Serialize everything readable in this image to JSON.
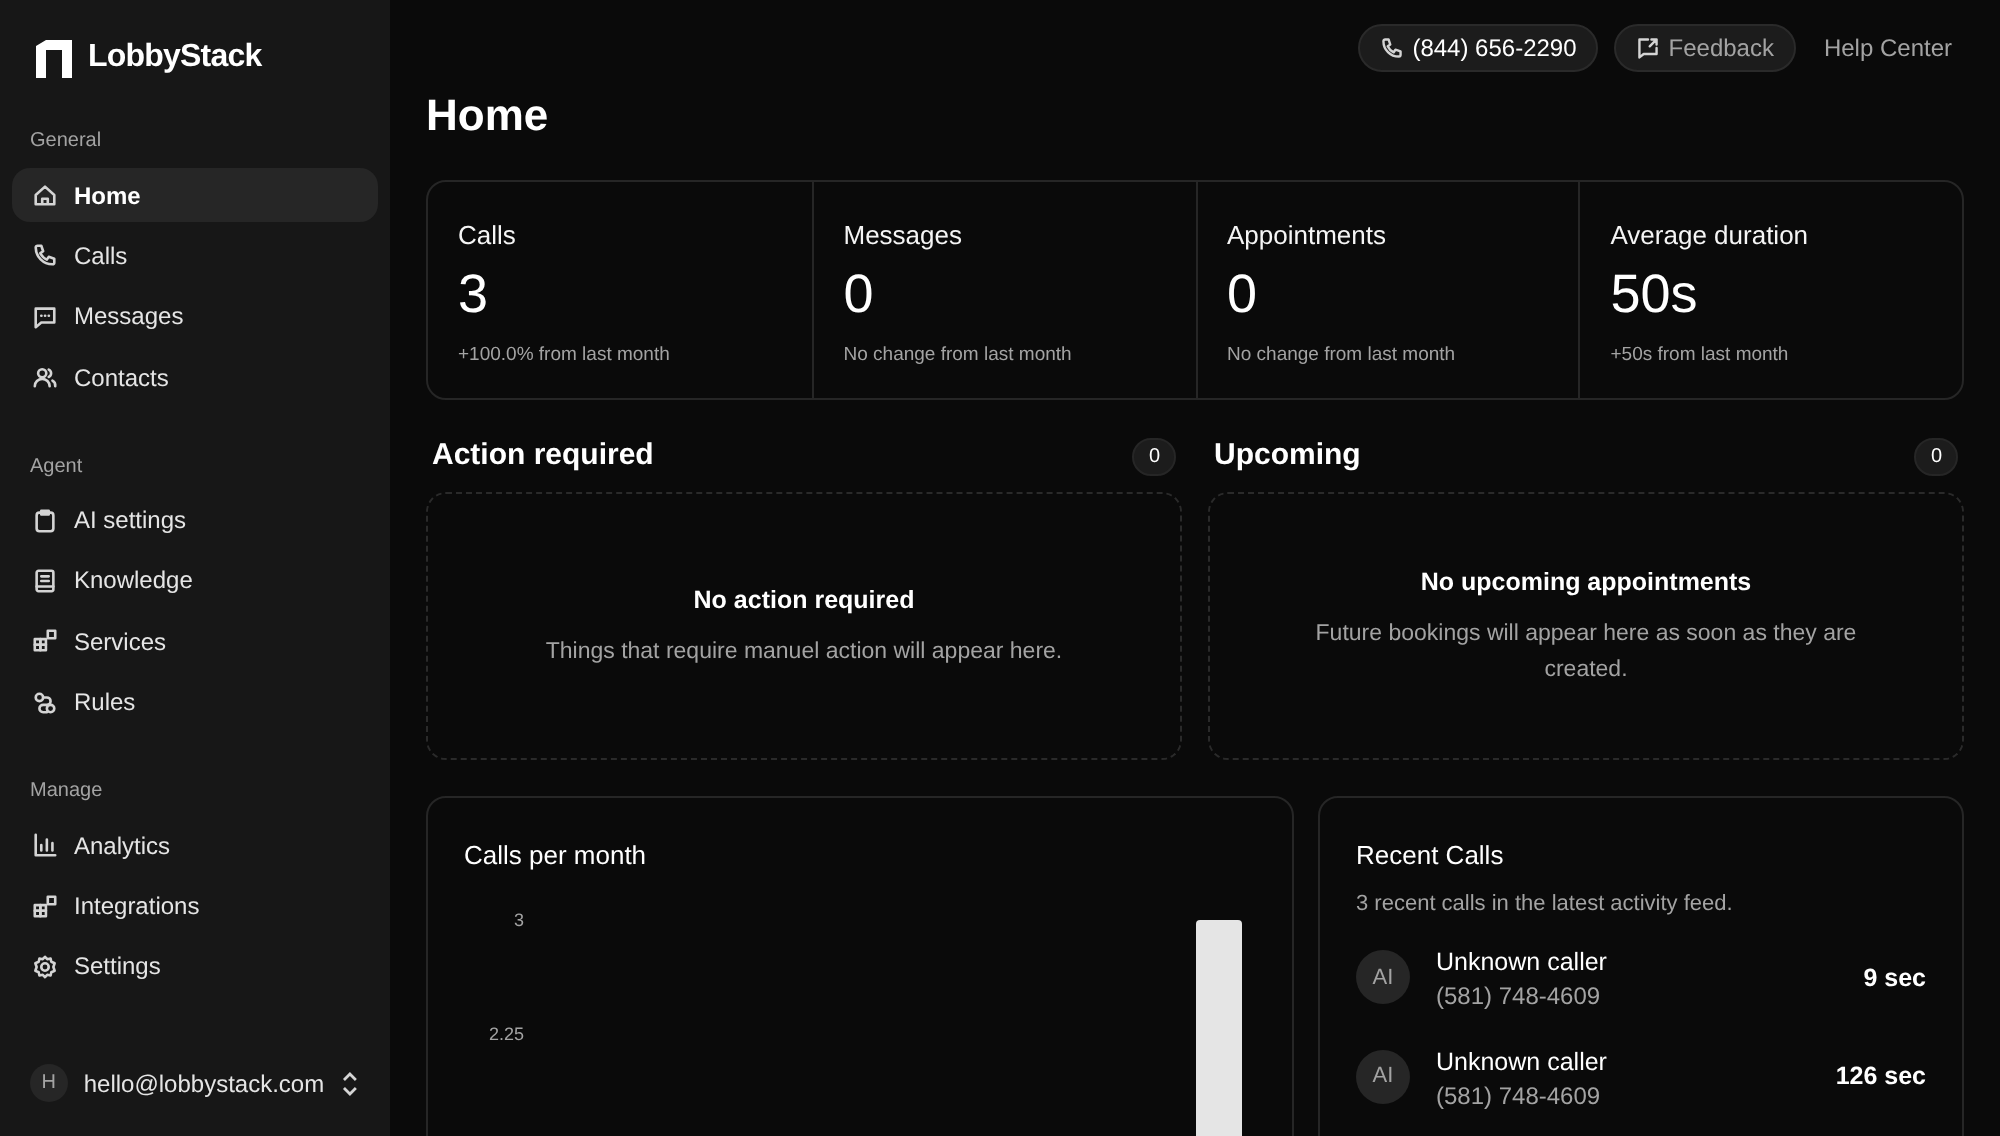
{
  "sidebar": {
    "brand": "LobbyStack",
    "sections": [
      {
        "title": "General",
        "items": [
          {
            "label": "Home",
            "selected": true
          },
          {
            "label": "Calls",
            "selected": false
          },
          {
            "label": "Messages",
            "selected": false
          },
          {
            "label": "Contacts",
            "selected": false
          }
        ]
      },
      {
        "title": "Agent",
        "items": [
          {
            "label": "AI settings",
            "selected": false
          },
          {
            "label": "Knowledge",
            "selected": false
          },
          {
            "label": "Services",
            "selected": false
          },
          {
            "label": "Rules",
            "selected": false
          }
        ]
      },
      {
        "title": "Manage",
        "items": [
          {
            "label": "Analytics",
            "selected": false
          },
          {
            "label": "Integrations",
            "selected": false
          },
          {
            "label": "Settings",
            "selected": false
          }
        ]
      }
    ],
    "account": {
      "avatar": "H",
      "email": "hello@lobbystack.com"
    }
  },
  "header": {
    "phone": "(844) 656-2290",
    "feedback": "Feedback",
    "help": "Help Center"
  },
  "title": "Home",
  "stats": [
    {
      "label": "Calls",
      "value": "3",
      "note": "+100.0% from last month"
    },
    {
      "label": "Messages",
      "value": "0",
      "note": "No change from last month"
    },
    {
      "label": "Appointments",
      "value": "0",
      "note": "No change from last month"
    },
    {
      "label": "Average duration",
      "value": "50s",
      "note": "+50s from last month"
    }
  ],
  "panels": [
    {
      "title": "Action required",
      "count": "0",
      "empty_title": "No action required",
      "empty_text": "Things that require manuel action will appear here."
    },
    {
      "title": "Upcoming",
      "count": "0",
      "empty_title": "No upcoming appointments",
      "empty_text": "Future bookings will appear here as soon as they are created."
    }
  ],
  "calls_chart": {
    "title": "Calls per month",
    "axis_labels": [
      "3",
      "2.25"
    ]
  },
  "recent_calls": {
    "title": "Recent Calls",
    "subtitle": "3 recent calls in the latest activity feed.",
    "items": [
      {
        "avatar": "AI",
        "name": "Unknown caller",
        "phone": "(581) 748-4609",
        "duration": "9 sec"
      },
      {
        "avatar": "AI",
        "name": "Unknown caller",
        "phone": "(581) 748-4609",
        "duration": "126 sec"
      }
    ]
  }
}
